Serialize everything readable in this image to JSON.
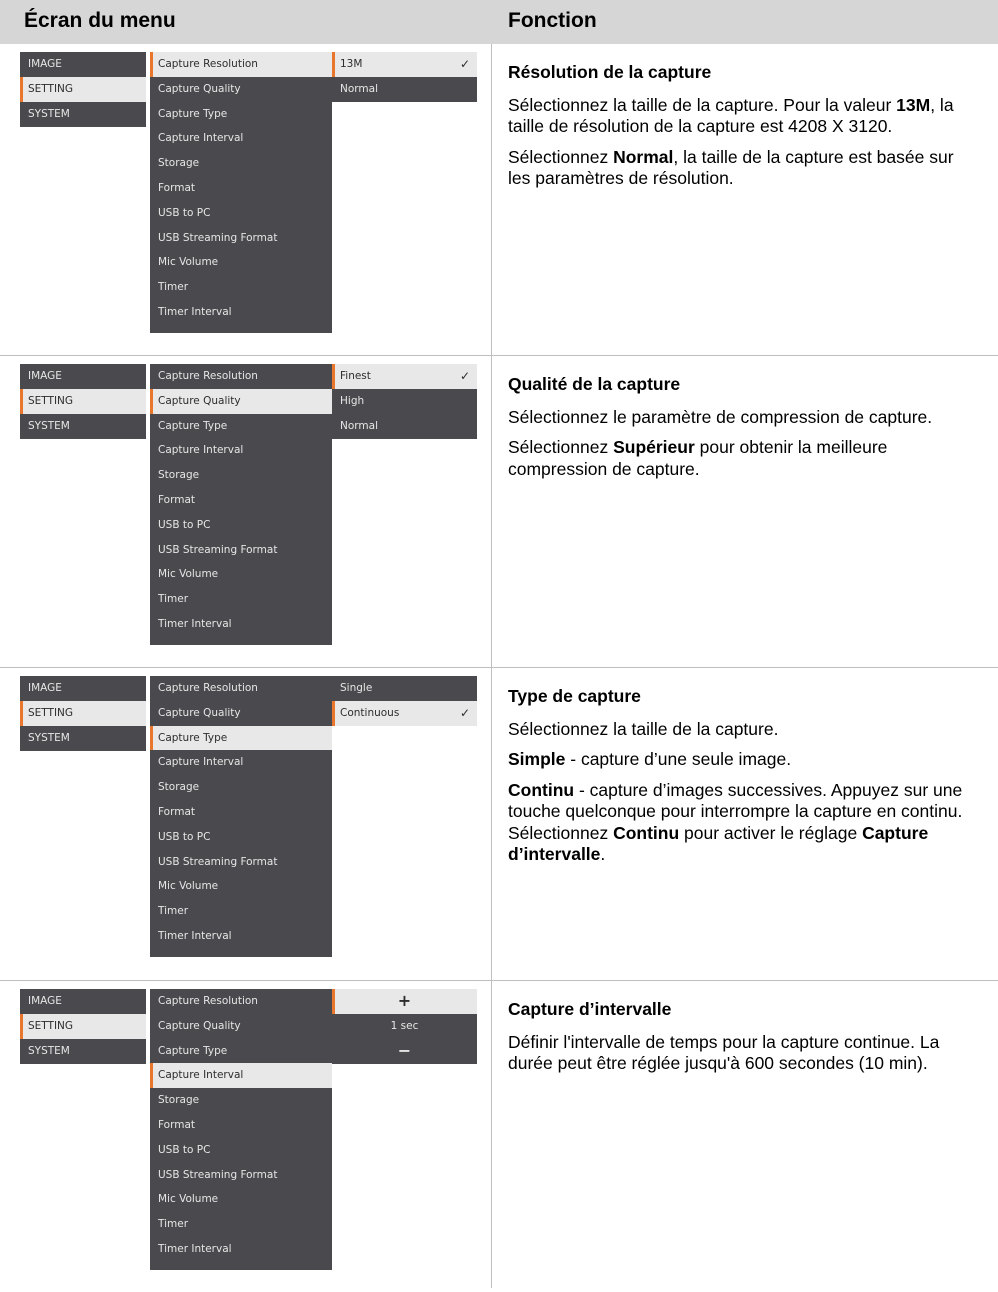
{
  "header": {
    "left": "Écran du menu",
    "right": "Fonction"
  },
  "main_menu": [
    "IMAGE",
    "SETTING",
    "SYSTEM"
  ],
  "submenu": [
    "Capture Resolution",
    "Capture Quality",
    "Capture Type",
    "Capture Interval",
    "Storage",
    "Format",
    "USB to PC",
    "USB Streaming Format",
    "Mic Volume",
    "Timer",
    "Timer Interval"
  ],
  "rows": [
    {
      "options": [
        "13M",
        "Normal"
      ],
      "title": "Résolution de la capture",
      "p1": {
        "a": "Sélectionnez la taille de la capture. Pour la valeur ",
        "b": "13M",
        "c": ", la taille de résolution de la capture est 4208 X 3120."
      },
      "p2": {
        "a": "Sélectionnez ",
        "b": "Normal",
        "c": ", la taille de la capture est basée sur les paramètres de résolution."
      }
    },
    {
      "options": [
        "Finest",
        "High",
        "Normal"
      ],
      "title": "Qualité de la capture",
      "p1": "Sélectionnez le paramètre de compression de capture.",
      "p2": {
        "a": "Sélectionnez ",
        "b": "Supérieur",
        "c": " pour obtenir la meilleure compression de capture."
      }
    },
    {
      "options": [
        "Single",
        "Continuous"
      ],
      "title": "Type de capture",
      "p1": "Sélectionnez la taille de la capture.",
      "p2": {
        "b": "Simple",
        "c": " - capture d’une seule image."
      },
      "p3": {
        "b": "Continu",
        "c": " - capture d’images successives. Appuyez sur une touche quelconque pour interrompre la capture en continu. Sélectionnez "
      },
      "p3b": {
        "b": "Continu",
        "c": " pour activer le réglage "
      },
      "p3c": {
        "b": "Capture d’intervalle",
        "c": "."
      }
    },
    {
      "options": [
        "+",
        "1 sec",
        "−"
      ],
      "title": "Capture d’intervalle",
      "p1": "Définir l'intervalle de temps pour la capture continue.  La durée peut être réglée jusqu'à 600 secondes (10 min)."
    }
  ]
}
